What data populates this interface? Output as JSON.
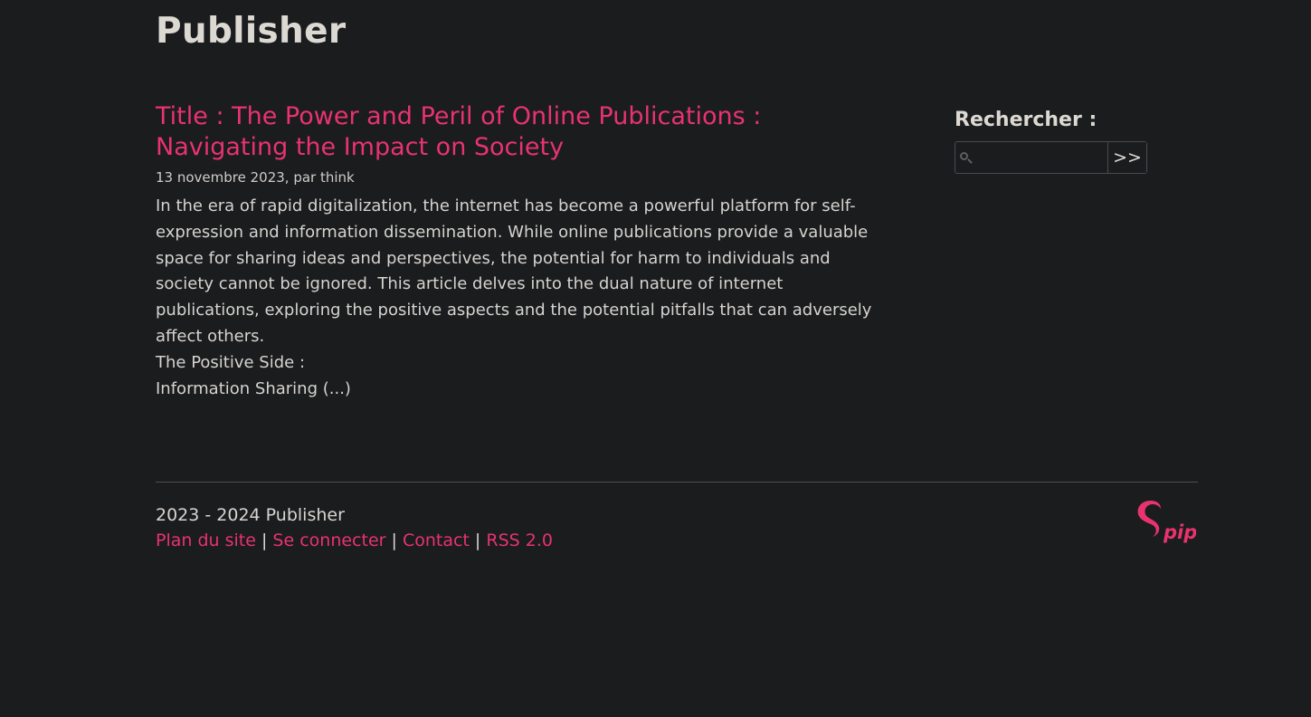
{
  "site": {
    "title": "Publisher"
  },
  "article": {
    "title": "Title : The Power and Peril of Online Publications : Navigating the Impact on Society",
    "meta": "13 novembre 2023, par think",
    "intro": "In the era of rapid digitalization, the internet has become a powerful platform for self-expression and information dissemination. While online publications provide a valuable space for sharing ideas and perspectives, the potential for harm to individuals and society cannot be ignored. This article delves into the dual nature of internet publications, exploring the positive aspects and the potential pitfalls that can adversely affect others.",
    "subheading": "The Positive Side :",
    "excerpt_end": "Information Sharing (...)"
  },
  "sidebar": {
    "search_title": "Rechercher :",
    "search_value": "",
    "search_button": ">>"
  },
  "footer": {
    "copyright": "2023 - 2024 Publisher",
    "links": {
      "site_map": "Plan du site",
      "login": "Se connecter",
      "contact": "Contact",
      "rss": "RSS 2.0"
    },
    "separator": "|",
    "logo": "spip-logo",
    "logo_color": "#e8336e"
  },
  "colors": {
    "background": "#1b1c1e",
    "accent": "#e8336e",
    "text": "#d6d3cf"
  }
}
